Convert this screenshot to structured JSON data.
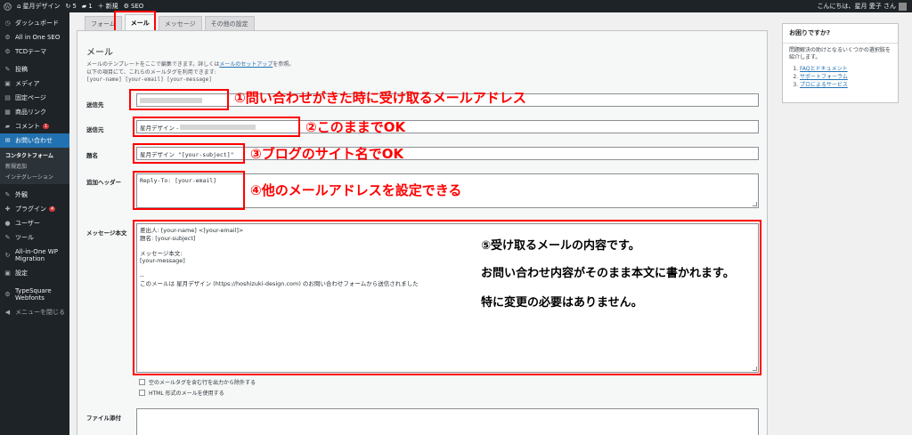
{
  "adminbar": {
    "wp_logo_icon": "wordpress-logo-icon",
    "site_name": "星月デザイン",
    "updates_count": "5",
    "comments_count": "1",
    "new_label": "新規",
    "seo_label": "SEO",
    "greeting": "こんにちは、星月 愛子 さん"
  },
  "sidebar": {
    "items": [
      {
        "icon": "dashboard-icon",
        "glyph": "◷",
        "label": "ダッシュボード"
      },
      {
        "icon": "aioseo-icon",
        "glyph": "⚙",
        "label": "All in One SEO"
      },
      {
        "icon": "tcd-icon",
        "glyph": "⚙",
        "label": "TCDテーマ"
      },
      {
        "icon": "posts-icon",
        "glyph": "✎",
        "label": "投稿"
      },
      {
        "icon": "media-icon",
        "glyph": "▣",
        "label": "メディア"
      },
      {
        "icon": "pages-icon",
        "glyph": "▤",
        "label": "固定ページ"
      },
      {
        "icon": "product-link-icon",
        "glyph": "▦",
        "label": "商品リンク"
      },
      {
        "icon": "comments-icon",
        "glyph": "▰",
        "label": "コメント",
        "badge": "1"
      },
      {
        "icon": "contact-icon",
        "glyph": "✉",
        "label": "お問い合わせ"
      }
    ],
    "submenu": [
      "コンタクトフォーム",
      "新規追加",
      "インテグレーション"
    ],
    "items2": [
      {
        "icon": "appearance-icon",
        "glyph": "✎",
        "label": "外観"
      },
      {
        "icon": "plugins-icon",
        "glyph": "✚",
        "label": "プラグイン",
        "badge": "4"
      },
      {
        "icon": "users-icon",
        "glyph": "●",
        "label": "ユーザー"
      },
      {
        "icon": "tools-icon",
        "glyph": "✎",
        "label": "ツール"
      },
      {
        "icon": "migration-icon",
        "glyph": "↻",
        "label": "All-in-One WP",
        "label2": "Migration"
      },
      {
        "icon": "settings-icon",
        "glyph": "▣",
        "label": "設定"
      },
      {
        "icon": "typesquare-icon",
        "glyph": "⚙",
        "label": "TypeSquare",
        "label2": "Webfonts"
      }
    ],
    "collapse": "メニューを閉じる"
  },
  "tabs": [
    "フォーム",
    "メール",
    "メッセージ",
    "その他の設定"
  ],
  "help": {
    "title": "お困りですか?",
    "text": "問題解決の助けとなるいくつかの選択肢を紹介します。",
    "links": [
      "FAQとドキュメント",
      "サポートフォーラム",
      "プロによるサービス"
    ]
  },
  "mail": {
    "title": "メール",
    "desc1_pre": "メールのテンプレートをここで編集できます。詳しくは",
    "desc1_link": "メールのセットアップ",
    "desc1_post": "を参照。",
    "desc2": "以下の項目にて、これらのメールタグを利用できます:",
    "tags": "[your-name] [your-email] [your-message]",
    "to_label": "送信先",
    "from_label": "送信元",
    "from_value": "星月デザイン -",
    "subject_label": "題名",
    "subject_value": "星月デザイン \"[your-subject]\"",
    "headers_label": "追加ヘッダー",
    "headers_value": "Reply-To: [your-email]",
    "body_label": "メッセージ本文",
    "body_lines": [
      "差出人: [your-name] <[your-email]>",
      "題名: [your-subject]",
      "",
      "メッセージ本文:",
      "[your-message]",
      "",
      "--",
      "このメールは 星月デザイン (https://hoshizuki-design.com) のお問い合わせフォームから送信されました"
    ],
    "chk1": "空のメールタグを含む行を出力から除外する",
    "chk2": "HTML 形式のメールを使用する",
    "attach_label": "ファイル添付"
  },
  "annotations": {
    "a1": "①問い合わせがきた時に受け取るメールアドレス",
    "a2": "②このままでOK",
    "a3": "③ブログのサイト名でOK",
    "a4": "④他のメールアドレスを設定できる",
    "a5": "⑤受け取るメールの内容です。",
    "a6": "お問い合わせ内容がそのまま本文に書かれます。",
    "a7": "特に変更の必要はありません。"
  }
}
